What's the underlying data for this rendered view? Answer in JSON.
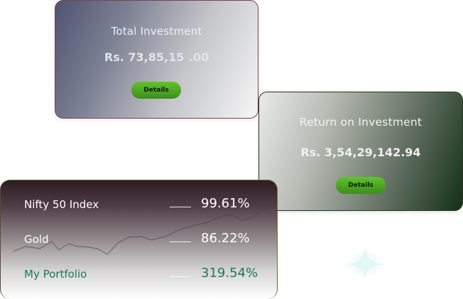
{
  "total_investment": {
    "title": "Total Investment",
    "amount": "Rs. 73,85,15  .00",
    "details_label": "Details"
  },
  "return_on_investment": {
    "title": "Return on Investment",
    "amount": "Rs. 3,54,29,142.94",
    "details_label": "Details"
  },
  "performance": {
    "rows": [
      {
        "label": "Nifty 50 Index",
        "value": "99.61%"
      },
      {
        "label": "Gold",
        "value": "86.22%"
      },
      {
        "label": "My Portfolio",
        "value": "319.54%"
      }
    ]
  },
  "colors": {
    "accent_green": "#5ab82a",
    "portfolio_text": "#1c7a56",
    "total_card_border": "#8a3b52",
    "return_card_dark": "#133016"
  },
  "icons": {
    "decor": "sparkle-icon"
  }
}
